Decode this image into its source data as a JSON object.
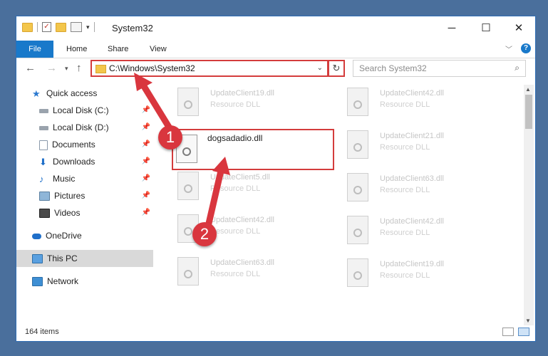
{
  "window": {
    "title": "System32",
    "controls": {
      "minimize": "─",
      "maximize": "☐",
      "close": "✕"
    }
  },
  "ribbon": {
    "file": "File",
    "tabs": [
      "Home",
      "Share",
      "View"
    ]
  },
  "address": {
    "path": "C:\\Windows\\System32"
  },
  "search": {
    "placeholder": "Search System32"
  },
  "nav_pane": {
    "quick_access": "Quick access",
    "items": [
      {
        "label": "Local Disk (C:)",
        "icon": "drive-icon",
        "pinned": true
      },
      {
        "label": "Local Disk (D:)",
        "icon": "drive-icon",
        "pinned": true
      },
      {
        "label": "Documents",
        "icon": "documents-icon",
        "pinned": true
      },
      {
        "label": "Downloads",
        "icon": "downloads-icon",
        "pinned": true
      },
      {
        "label": "Music",
        "icon": "music-icon",
        "pinned": true
      },
      {
        "label": "Pictures",
        "icon": "pictures-icon",
        "pinned": true
      },
      {
        "label": "Videos",
        "icon": "videos-icon",
        "pinned": true
      }
    ],
    "onedrive": "OneDrive",
    "this_pc": "This PC",
    "network": "Network"
  },
  "files": {
    "highlighted": {
      "name": "dogsadadio.dll"
    },
    "left_column": [
      {
        "name": "UpdateClient19.dll",
        "type": "Resource DLL"
      },
      {
        "name": "UpdateClient5.dll",
        "type": "Resource DLL"
      },
      {
        "name": "UpdateClient42.dll",
        "type": "Resource DLL"
      },
      {
        "name": "UpdateClient63.dll",
        "type": "Resource DLL"
      }
    ],
    "right_column": [
      {
        "name": "UpdateClient42.dll",
        "type": "Resource DLL"
      },
      {
        "name": "UpdateClient21.dll",
        "type": "Resource DLL"
      },
      {
        "name": "UpdateClient63.dll",
        "type": "Resource DLL"
      },
      {
        "name": "UpdateClient42.dll",
        "type": "Resource DLL"
      },
      {
        "name": "UpdateClient19.dll",
        "type": "Resource DLL"
      }
    ]
  },
  "status": {
    "count": "164 items"
  },
  "annotations": {
    "step1": "1",
    "step2": "2",
    "color": "#d9363e"
  }
}
